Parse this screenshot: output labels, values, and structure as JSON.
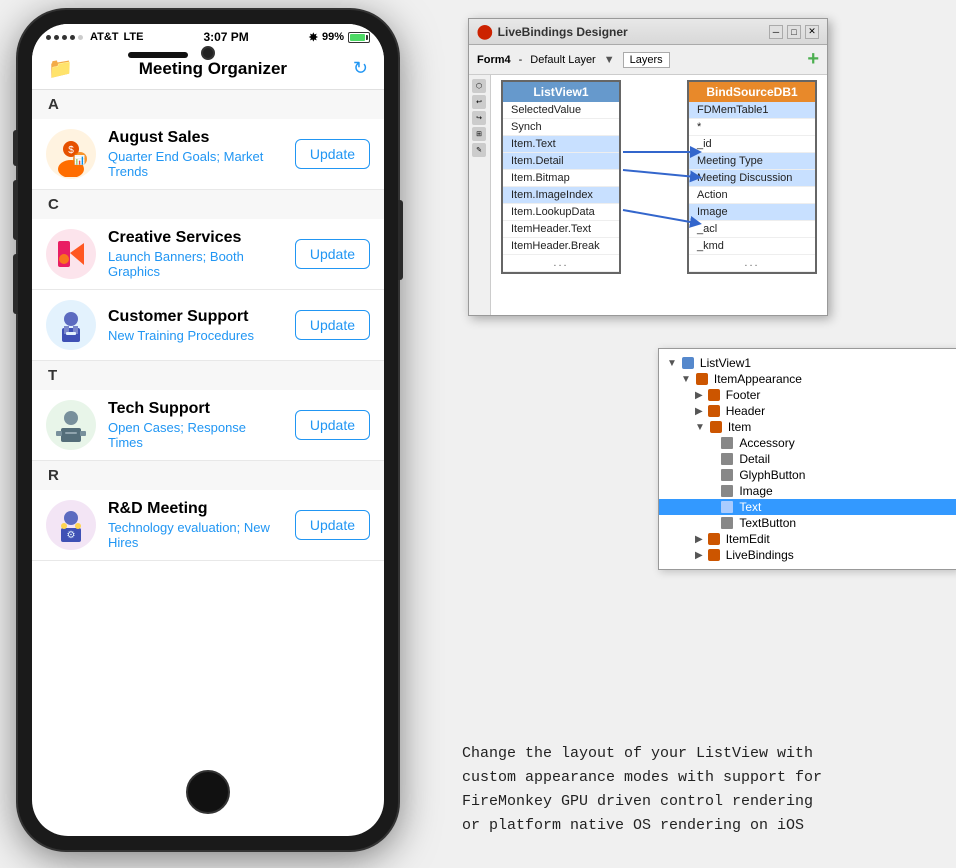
{
  "phone": {
    "status": {
      "carrier": "AT&T",
      "network": "LTE",
      "time": "3:07 PM",
      "battery_pct": "99%"
    },
    "nav": {
      "title": "Meeting Organizer",
      "folder_icon": "📁",
      "refresh_icon": "↻"
    },
    "sections": [
      {
        "letter": "A",
        "items": [
          {
            "name": "August Sales",
            "detail": "Quarter End Goals; Market Trends",
            "button": "Update",
            "avatar_type": "aug"
          }
        ]
      },
      {
        "letter": "C",
        "items": [
          {
            "name": "Creative Services",
            "detail": "Launch Banners; Booth Graphics",
            "button": "Update",
            "avatar_type": "creative"
          },
          {
            "name": "Customer Support",
            "detail": "New Training Procedures",
            "button": "Update",
            "avatar_type": "support"
          }
        ]
      },
      {
        "letter": "T",
        "items": [
          {
            "name": "Tech Support",
            "detail": "Open Cases; Response Times",
            "button": "Update",
            "avatar_type": "tech"
          }
        ]
      },
      {
        "letter": "R",
        "items": [
          {
            "name": "R&D Meeting",
            "detail": "Technology evaluation; New Hires",
            "button": "Update",
            "avatar_type": "rd"
          }
        ]
      }
    ]
  },
  "designer": {
    "title": "LiveBindings Designer",
    "form": "Form4",
    "layer": "Default Layer",
    "layers_btn": "Layers",
    "add_btn": "+",
    "listview_box": {
      "header": "ListView1",
      "fields": [
        "SelectedValue",
        "Synch",
        "Item.Text",
        "Item.Detail",
        "Item.Bitmap",
        "Item.ImageIndex",
        "Item.LookupData",
        "ItemHeader.Text",
        "ItemHeader.Break",
        "..."
      ]
    },
    "binddb_box": {
      "header": "BindSourceDB1",
      "fields": [
        "FDMemTable1",
        "*",
        "_id",
        "Meeting Type",
        "Meeting Discussion",
        "Action",
        "Image",
        "_acl",
        "_kmd",
        "..."
      ]
    }
  },
  "tree": {
    "items": [
      {
        "label": "ListView1",
        "indent": 0,
        "icon": "▶",
        "type": "component"
      },
      {
        "label": "ItemAppearance",
        "indent": 1,
        "icon": "▶",
        "type": "sub"
      },
      {
        "label": "Footer",
        "indent": 2,
        "icon": "▶",
        "type": "sub"
      },
      {
        "label": "Header",
        "indent": 2,
        "icon": "▶",
        "type": "sub"
      },
      {
        "label": "Item",
        "indent": 2,
        "icon": "▶",
        "type": "sub"
      },
      {
        "label": "Accessory",
        "indent": 3,
        "icon": "",
        "type": "leaf"
      },
      {
        "label": "Detail",
        "indent": 3,
        "icon": "",
        "type": "leaf"
      },
      {
        "label": "GlyphButton",
        "indent": 3,
        "icon": "",
        "type": "leaf"
      },
      {
        "label": "Image",
        "indent": 3,
        "icon": "",
        "type": "leaf"
      },
      {
        "label": "Text",
        "indent": 3,
        "icon": "",
        "type": "leaf",
        "selected": true
      },
      {
        "label": "TextButton",
        "indent": 3,
        "icon": "",
        "type": "leaf"
      },
      {
        "label": "ItemEdit",
        "indent": 2,
        "icon": "▶",
        "type": "sub"
      },
      {
        "label": "LiveBindings",
        "indent": 2,
        "icon": "▶",
        "type": "sub"
      }
    ]
  },
  "description": {
    "lines": [
      "Change the layout of your ListView with",
      "custom appearance modes with support for",
      "FireMonkey GPU driven control rendering",
      "or platform native OS rendering on iOS"
    ]
  }
}
